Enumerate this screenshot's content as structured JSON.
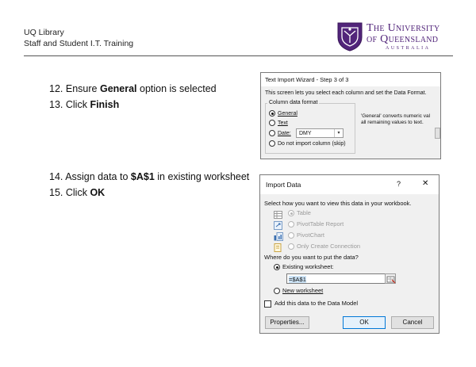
{
  "header": {
    "org_line1": "UQ Library",
    "org_line2": "Staff and Student I.T. Training",
    "uni_line1": "The University",
    "uni_line2": "of Queensland",
    "uni_line3": "AUSTRALIA"
  },
  "steps": [
    {
      "num": "12.",
      "pre": "Ensure ",
      "bold": "General",
      "post": " option is selected"
    },
    {
      "num": "13.",
      "pre": "Click ",
      "bold": "Finish",
      "post": ""
    },
    {
      "num": "14.",
      "pre": "Assign data to ",
      "bold": "$A$1",
      "post": " in existing worksheet"
    },
    {
      "num": "15.",
      "pre": "Click ",
      "bold": "OK",
      "post": ""
    }
  ],
  "wizard": {
    "title": "Text Import Wizard - Step 3 of 3",
    "instruction": "This screen lets you select each column and set the Data Format.",
    "group_label": "Column data format",
    "options": [
      "General",
      "Text",
      "Date:",
      "Do not import column (skip)"
    ],
    "date_value": "DMY",
    "note_line1": "'General' converts numeric val",
    "note_line2": "all remaining values to text."
  },
  "import": {
    "title": "Import Data",
    "help": "?",
    "close": "✕",
    "view_prompt": "Select how you want to view this data in your workbook.",
    "view_options": [
      "Table",
      "PivotTable Report",
      "PivotChart",
      "Only Create Connection"
    ],
    "put_prompt": "Where do you want to put the data?",
    "existing_label": "Existing worksheet:",
    "existing_value": "=$A$1",
    "new_label": "New worksheet",
    "model_label": "Add this data to the Data Model",
    "properties_button": "Properties...",
    "ok_button": "OK",
    "cancel_button": "Cancel"
  }
}
